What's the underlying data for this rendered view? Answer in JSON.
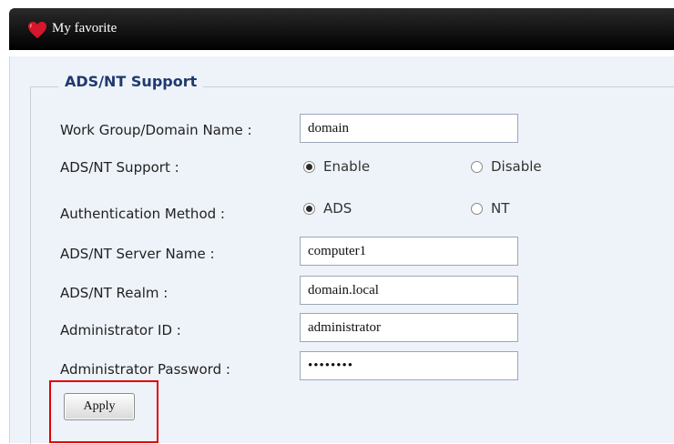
{
  "header": {
    "title": "My favorite",
    "icon": "heart-icon"
  },
  "section": {
    "legend": "ADS/NT Support"
  },
  "form": {
    "workgroup": {
      "label": "Work Group/Domain Name :",
      "value": "domain"
    },
    "ads_support": {
      "label": "ADS/NT Support :",
      "options": [
        "Enable",
        "Disable"
      ],
      "selected": "Enable"
    },
    "auth_method": {
      "label": "Authentication Method :",
      "options": [
        "ADS",
        "NT"
      ],
      "selected": "ADS"
    },
    "server_name": {
      "label": "ADS/NT Server Name :",
      "value": "computer1"
    },
    "realm": {
      "label": "ADS/NT Realm :",
      "value": "domain.local"
    },
    "admin_id": {
      "label": "Administrator ID :",
      "value": "administrator"
    },
    "admin_password": {
      "label": "Administrator Password :",
      "value": "••••••••"
    }
  },
  "actions": {
    "apply_label": "Apply"
  },
  "colors": {
    "highlight": "#e00000",
    "legend": "#1f3a6e",
    "panel_bg": "#eef3fa"
  }
}
